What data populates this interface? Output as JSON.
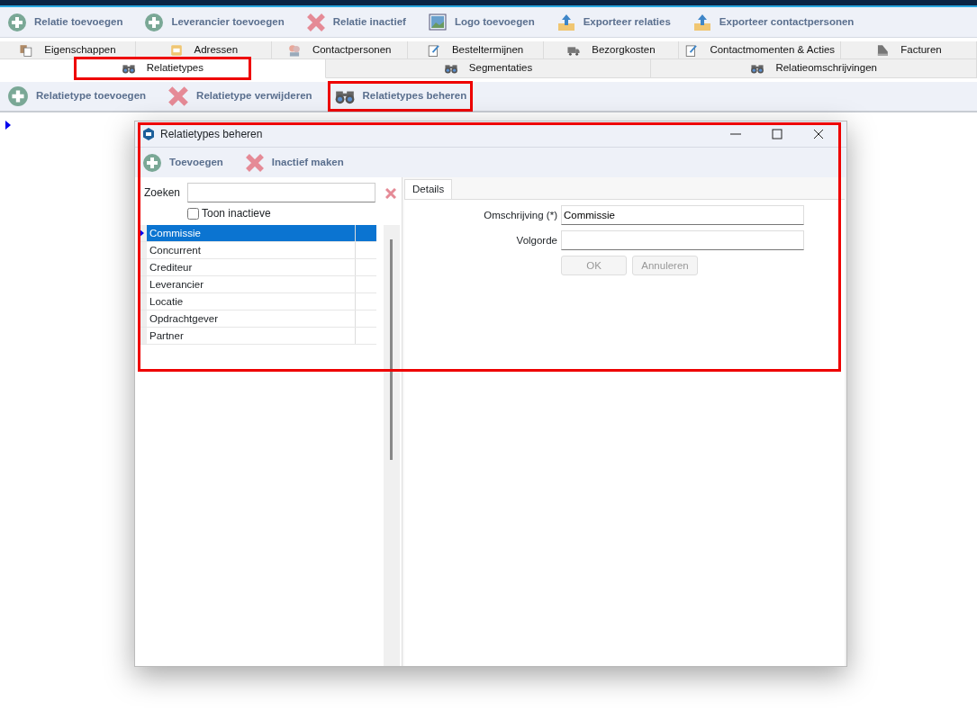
{
  "toolbar": [
    {
      "label": "Relatie toevoegen",
      "kind": "add"
    },
    {
      "label": "Leverancier toevoegen",
      "kind": "add"
    },
    {
      "label": "Relatie inactief",
      "kind": "remove"
    },
    {
      "label": "Logo toevoegen",
      "kind": "picture"
    },
    {
      "label": "Exporteer relaties",
      "kind": "export"
    },
    {
      "label": "Exporteer contactpersonen",
      "kind": "export"
    }
  ],
  "tabs_row_1": [
    {
      "label": "Eigenschappen",
      "kind": "pages",
      "selected": false
    },
    {
      "label": "Adressen",
      "kind": "address",
      "selected": false
    },
    {
      "label": "Contactpersonen",
      "kind": "people",
      "selected": false
    },
    {
      "label": "Besteltermijnen",
      "kind": "note",
      "selected": false
    },
    {
      "label": "Bezorgkosten",
      "kind": "truck",
      "selected": false
    },
    {
      "label": "Contactmomenten & Acties",
      "kind": "note",
      "selected": false
    },
    {
      "label": "Facturen",
      "kind": "invoice",
      "selected": false
    }
  ],
  "tabs_row_2": [
    {
      "label": "Relatietypes",
      "kind": "binoculars",
      "selected": true,
      "highlighted": true
    },
    {
      "label": "Segmentaties",
      "kind": "binoculars",
      "selected": false,
      "highlighted": false
    },
    {
      "label": "Relatieomschrijvingen",
      "kind": "binoculars",
      "selected": false,
      "highlighted": false
    }
  ],
  "sub_toolbar": [
    {
      "label": "Relatietype toevoegen",
      "kind": "add",
      "highlighted": false
    },
    {
      "label": "Relatietype verwijderen",
      "kind": "remove",
      "highlighted": false
    },
    {
      "label": "Relatietypes beheren",
      "kind": "binoculars",
      "highlighted": true
    }
  ],
  "dialog": {
    "title": "Relatietypes beheren",
    "highlighted": true,
    "toolbar": [
      {
        "label": "Toevoegen",
        "kind": "add"
      },
      {
        "label": "Inactief maken",
        "kind": "remove"
      }
    ],
    "search": {
      "label": "Zoeken"
    },
    "show_inactive": {
      "label": "Toon inactieve",
      "checked": false
    },
    "rows": [
      {
        "name": "Commissie",
        "selected": true
      },
      {
        "name": "Concurrent",
        "selected": false
      },
      {
        "name": "Crediteur",
        "selected": false
      },
      {
        "name": "Leverancier",
        "selected": false
      },
      {
        "name": "Locatie",
        "selected": false
      },
      {
        "name": "Opdrachtgever",
        "selected": false
      },
      {
        "name": "Partner",
        "selected": false
      }
    ],
    "details_tab": "Details",
    "fields": [
      {
        "label": "Omschrijving (*)",
        "value": "Commissie"
      },
      {
        "label": "Volgorde"
      }
    ],
    "buttons": [
      {
        "label": "OK",
        "disabled": true
      },
      {
        "label": "Annuleren",
        "disabled": true
      }
    ]
  }
}
